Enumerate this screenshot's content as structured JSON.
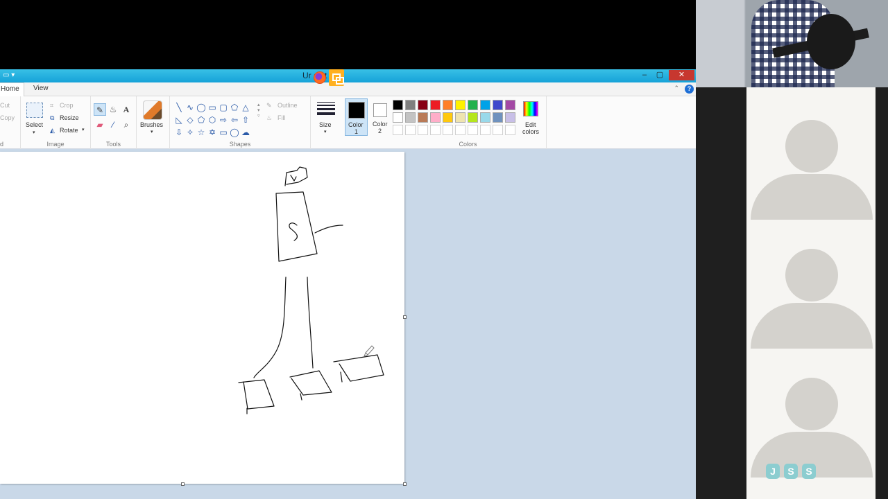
{
  "window": {
    "title": "Untitled - Paint",
    "title_visible": "Ur          aint"
  },
  "tabs": {
    "home": "Home",
    "view": "View"
  },
  "ribbon": {
    "clipboard": {
      "cut": "Cut",
      "copy": "Copy"
    },
    "image": {
      "label": "Image",
      "select": "Select",
      "crop": "Crop",
      "resize": "Resize",
      "rotate": "Rotate"
    },
    "tools": {
      "label": "Tools"
    },
    "brushes": {
      "label": "Brushes"
    },
    "shapes": {
      "label": "Shapes",
      "outline": "Outline",
      "fill": "Fill"
    },
    "size": {
      "label": "Size"
    },
    "color1": {
      "label": "Color",
      "num": "1",
      "color": "#000000"
    },
    "color2": {
      "label": "Color",
      "num": "2",
      "color": "#ffffff"
    },
    "colors": {
      "label": "Colors",
      "edit": "Edit",
      "edit2": "colors",
      "row1": [
        "#000000",
        "#7f7f7f",
        "#880015",
        "#ed1c24",
        "#ff7f27",
        "#fff200",
        "#22b14c",
        "#00a2e8",
        "#3f48cc",
        "#a349a4"
      ],
      "row2": [
        "#ffffff",
        "#c3c3c3",
        "#b97a57",
        "#ffaec9",
        "#ffc90e",
        "#efe4b0",
        "#b5e61d",
        "#99d9ea",
        "#7092be",
        "#c8bfe7"
      ],
      "row3": [
        "#ffffff",
        "#ffffff",
        "#ffffff",
        "#ffffff",
        "#ffffff",
        "#ffffff",
        "#ffffff",
        "#ffffff",
        "#ffffff",
        "#ffffff"
      ]
    }
  },
  "call": {
    "logo": [
      "J",
      "S",
      "S"
    ]
  }
}
